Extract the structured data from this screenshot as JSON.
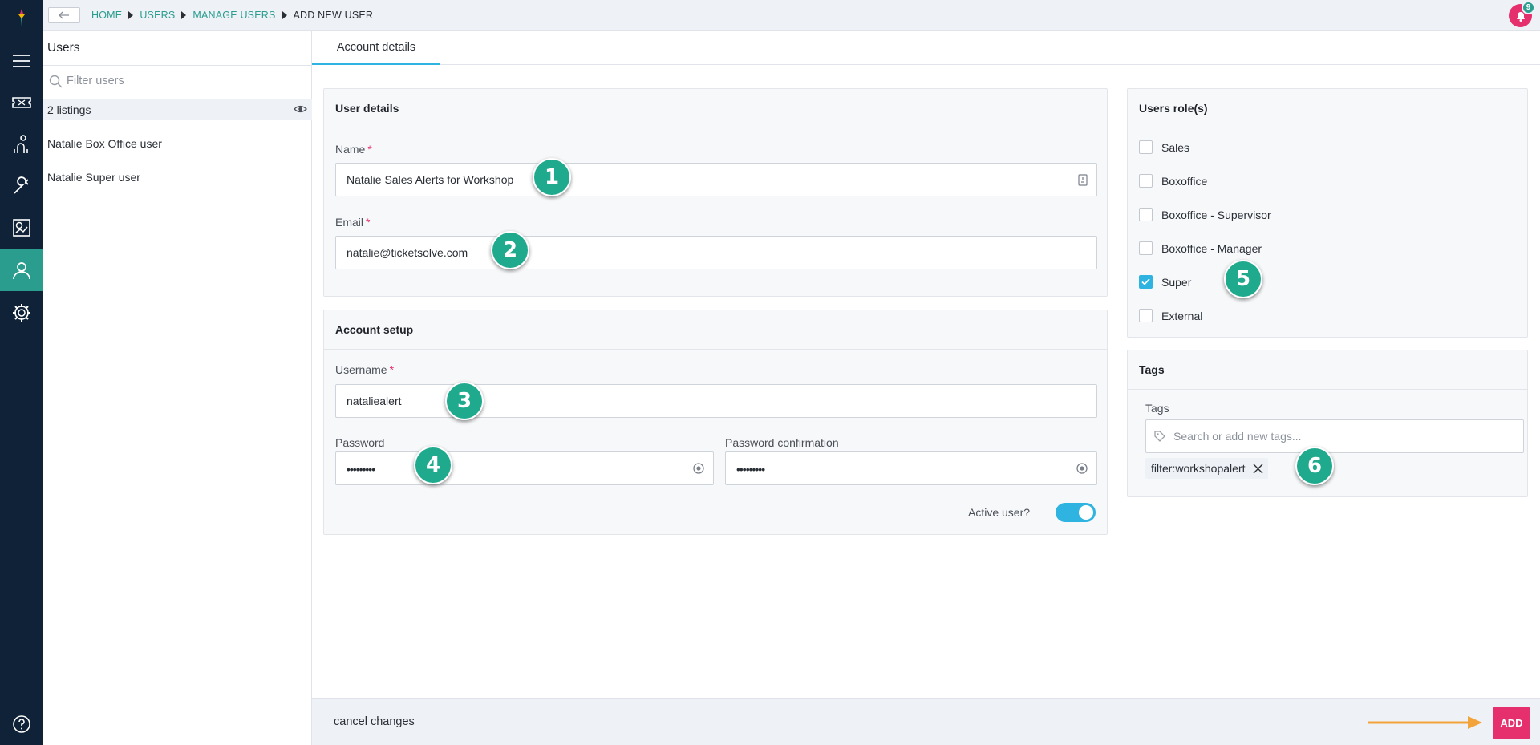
{
  "breadcrumb": {
    "items": [
      "HOME",
      "USERS",
      "MANAGE USERS",
      "ADD NEW USER"
    ]
  },
  "notifications": {
    "count": "9"
  },
  "users_panel": {
    "title": "Users",
    "filter_placeholder": "Filter users",
    "listings": "2 listings",
    "users": [
      "Natalie Box Office user",
      "Natalie Super user"
    ]
  },
  "tabs": {
    "account_details": "Account details"
  },
  "user_details": {
    "title": "User details",
    "name_label": "Name",
    "name_value": "Natalie Sales Alerts for Workshop",
    "email_label": "Email",
    "email_value": "natalie@ticketsolve.com"
  },
  "account_setup": {
    "title": "Account setup",
    "username_label": "Username",
    "username_value": "nataliealert",
    "password_label": "Password",
    "password_value": "•••••••••",
    "confirm_label": "Password confirmation",
    "confirm_value": "•••••••••",
    "active_label": "Active user?",
    "active": true
  },
  "roles": {
    "title": "Users role(s)",
    "items": [
      {
        "label": "Sales",
        "checked": false
      },
      {
        "label": "Boxoffice",
        "checked": false
      },
      {
        "label": "Boxoffice - Supervisor",
        "checked": false
      },
      {
        "label": "Boxoffice - Manager",
        "checked": false
      },
      {
        "label": "Super",
        "checked": true
      },
      {
        "label": "External",
        "checked": false
      }
    ]
  },
  "tags": {
    "title": "Tags",
    "field_label": "Tags",
    "placeholder": "Search or add new tags...",
    "chips": [
      "filter:workshopalert"
    ]
  },
  "annotations": [
    "1",
    "2",
    "3",
    "4",
    "5",
    "6"
  ],
  "footer": {
    "cancel": "cancel changes",
    "add": "ADD"
  },
  "colors": {
    "accent": "#2a9d8f",
    "primary": "#e5306d",
    "toggle": "#2fb3e0",
    "nav": "#0f2238"
  }
}
